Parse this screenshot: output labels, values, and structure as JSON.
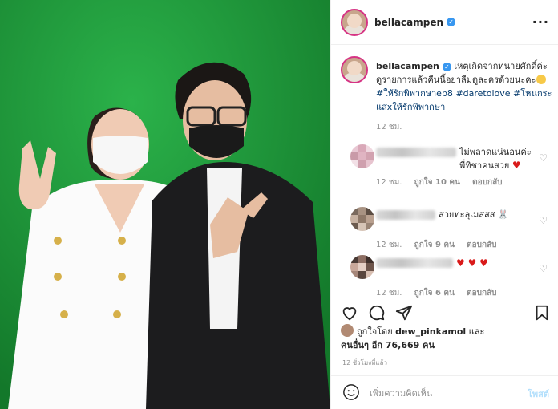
{
  "post": {
    "username": "bellacampen",
    "caption_text": "เหตุเกิดจากทนายศักดิ์ค่ะ ดูรายการแล้วคืนนี้อย่าลืมดูละครด้วยนะคะ",
    "hashtags": [
      "#ให้รักพิพากษาep8",
      "#daretolove",
      "#โหนกระแสxให้รักพิพากษา"
    ],
    "caption_time": "12 ชม."
  },
  "comments": [
    {
      "text": "ไม่พลาดแน่นอนค่ะพี่ทิชาคนสวย",
      "emoji": "♥",
      "time": "12 ชม.",
      "likes": "ถูกใจ 10 คน",
      "reply": "ตอบกลับ"
    },
    {
      "text": "สวยทะลุเมสสส",
      "emoji": "🐰",
      "time": "12 ชม.",
      "likes": "ถูกใจ 9 คน",
      "reply": "ตอบกลับ"
    },
    {
      "text": "",
      "emoji": "♥ ♥ ♥",
      "time": "12 ชม.",
      "likes": "ถูกใจ 6 คน",
      "reply": "ตอบกลับ"
    }
  ],
  "likes": {
    "liked_by_prefix": "ถูกใจโดย",
    "liked_by_user": "dew_pinkamol",
    "and": "และ",
    "others": "คนอื่นๆ อีก 76,669 คน"
  },
  "timestamp": "12 ชั่วโมงที่แล้ว",
  "comment_box": {
    "placeholder": "เพิ่มความคิดเห็น",
    "post_label": "โพสต์"
  },
  "icons": [
    "verified-badge-icon",
    "more-options-icon",
    "heart-icon",
    "comment-icon",
    "share-icon",
    "bookmark-icon",
    "emoji-icon"
  ],
  "colors": {
    "green_screen": "#1f9a3a",
    "verified": "#3897f0",
    "hashtag": "#00376b",
    "heart": "#d91a1a",
    "post_button": "#b2dffc"
  }
}
